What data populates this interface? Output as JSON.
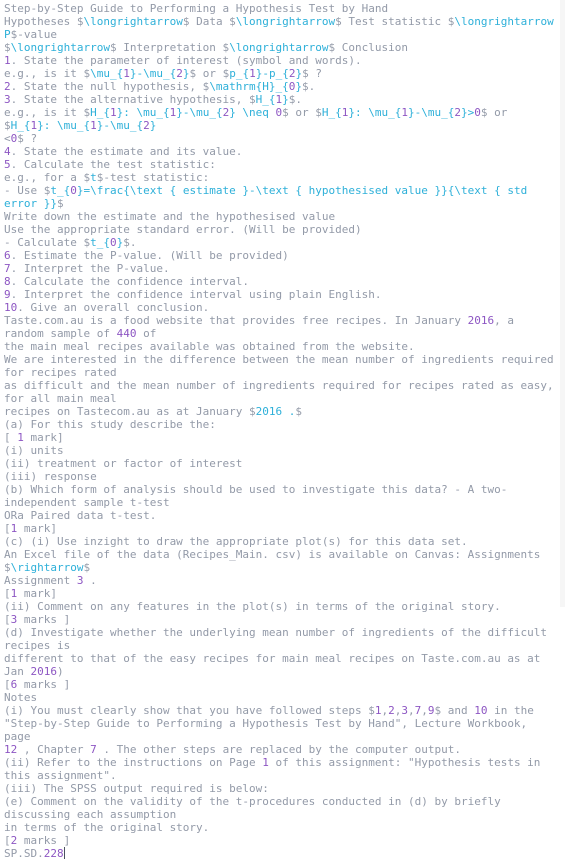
{
  "lines": [
    {
      "segs": [
        [
          "Step-by-Step Guide to Performing a Hypothesis Test by Hand",
          ""
        ]
      ]
    },
    {
      "segs": [
        [
          "Hypotheses $",
          ""
        ],
        [
          "\\longrightarrow",
          "math"
        ],
        [
          "$ Data $",
          ""
        ],
        [
          "\\longrightarrow",
          "math"
        ],
        [
          "$ Test statistic $",
          ""
        ],
        [
          "\\longrightarrow P",
          "math"
        ],
        [
          "$-value",
          ""
        ]
      ]
    },
    {
      "segs": [
        [
          "$",
          ""
        ],
        [
          "\\longrightarrow",
          "math"
        ],
        [
          "$ Interpretation $",
          ""
        ],
        [
          "\\longrightarrow",
          "math"
        ],
        [
          "$ Conclusion",
          ""
        ]
      ]
    },
    {
      "segs": [
        [
          "1",
          "num"
        ],
        [
          ". State the parameter of interest (symbol and words).",
          ""
        ]
      ]
    },
    {
      "segs": [
        [
          "e.g., is it $",
          ""
        ],
        [
          "\\mu_{",
          "math"
        ],
        [
          "1",
          "num"
        ],
        [
          "}-\\mu_{",
          "math"
        ],
        [
          "2",
          "num"
        ],
        [
          "}",
          "math"
        ],
        [
          "$ or $",
          ""
        ],
        [
          "p_{",
          "math"
        ],
        [
          "1",
          "num"
        ],
        [
          "}-p_{",
          "math"
        ],
        [
          "2",
          "num"
        ],
        [
          "}",
          "math"
        ],
        [
          "$ ?",
          ""
        ]
      ]
    },
    {
      "segs": [
        [
          "2",
          "num"
        ],
        [
          ". State the null hypothesis, $",
          ""
        ],
        [
          "\\mathrm{H}_{",
          "math"
        ],
        [
          "0",
          "num"
        ],
        [
          "}",
          "math"
        ],
        [
          "$.",
          ""
        ]
      ]
    },
    {
      "segs": [
        [
          "3",
          "num"
        ],
        [
          ". State the alternative hypothesis, $",
          ""
        ],
        [
          "H_{",
          "math"
        ],
        [
          "1",
          "num"
        ],
        [
          "}",
          "math"
        ],
        [
          "$.",
          ""
        ]
      ]
    },
    {
      "segs": [
        [
          "e.g., is it $",
          ""
        ],
        [
          "H_{",
          "math"
        ],
        [
          "1",
          "num"
        ],
        [
          "}: \\mu_{",
          "math"
        ],
        [
          "1",
          "num"
        ],
        [
          "}-\\mu_{",
          "math"
        ],
        [
          "2",
          "num"
        ],
        [
          "} \\neq ",
          "math"
        ],
        [
          "0",
          "num"
        ],
        [
          "$ or $",
          ""
        ],
        [
          "H_{",
          "math"
        ],
        [
          "1",
          "num"
        ],
        [
          "}: \\mu_{",
          "math"
        ],
        [
          "1",
          "num"
        ],
        [
          "}-\\mu_{",
          "math"
        ],
        [
          "2",
          "num"
        ],
        [
          "}>",
          "math"
        ],
        [
          "0",
          "num"
        ],
        [
          "$ or $",
          ""
        ],
        [
          "H_{",
          "math"
        ],
        [
          "1",
          "num"
        ],
        [
          "}: \\mu_{",
          "math"
        ],
        [
          "1",
          "num"
        ],
        [
          "}-\\mu_{",
          "math"
        ],
        [
          "2",
          "num"
        ],
        [
          "}",
          "math"
        ]
      ]
    },
    {
      "segs": [
        [
          "<",
          ""
        ],
        [
          "0",
          "num"
        ],
        [
          "$ ?",
          ""
        ]
      ]
    },
    {
      "segs": [
        [
          "4",
          "num"
        ],
        [
          ". State the estimate and its value.",
          ""
        ]
      ]
    },
    {
      "segs": [
        [
          "5",
          "num"
        ],
        [
          ". Calculate the test statistic:",
          ""
        ]
      ]
    },
    {
      "segs": [
        [
          "e.g., for a $",
          ""
        ],
        [
          "t",
          "math"
        ],
        [
          "$-test statistic:",
          ""
        ]
      ]
    },
    {
      "segs": [
        [
          "- Use $",
          ""
        ],
        [
          "t_{",
          "math"
        ],
        [
          "0",
          "num"
        ],
        [
          "}=\\frac{\\text { estimate }-\\text { hypothesised value }}{\\text { std error }}",
          "math"
        ],
        [
          "$",
          ""
        ]
      ]
    },
    {
      "segs": [
        [
          "Write down the estimate and the hypothesised value",
          ""
        ]
      ]
    },
    {
      "segs": [
        [
          "Use the appropriate standard error. (Will be provided)",
          ""
        ]
      ]
    },
    {
      "segs": [
        [
          "- Calculate $",
          ""
        ],
        [
          "t_{",
          "math"
        ],
        [
          "0",
          "num"
        ],
        [
          "}",
          "math"
        ],
        [
          "$.",
          ""
        ]
      ]
    },
    {
      "segs": [
        [
          "6",
          "num"
        ],
        [
          ". Estimate the P-value. (Will be provided)",
          ""
        ]
      ]
    },
    {
      "segs": [
        [
          "7",
          "num"
        ],
        [
          ". Interpret the P-value.",
          ""
        ]
      ]
    },
    {
      "segs": [
        [
          "8",
          "num"
        ],
        [
          ". Calculate the confidence interval.",
          ""
        ]
      ]
    },
    {
      "segs": [
        [
          "9",
          "num"
        ],
        [
          ". Interpret the confidence interval using plain English.",
          ""
        ]
      ]
    },
    {
      "segs": [
        [
          "10",
          "num"
        ],
        [
          ". Give an overall conclusion.",
          ""
        ]
      ]
    },
    {
      "segs": [
        [
          "Taste.com.au is a food website that provides free recipes. In January ",
          ""
        ],
        [
          "2016",
          "num"
        ],
        [
          ", a random sample of ",
          ""
        ],
        [
          "440",
          "num"
        ],
        [
          " of",
          ""
        ]
      ]
    },
    {
      "segs": [
        [
          "the main meal recipes available was obtained from the website.",
          ""
        ]
      ]
    },
    {
      "segs": [
        [
          "We are interested in the difference between the mean number of ingredients required for recipes rated",
          ""
        ]
      ]
    },
    {
      "segs": [
        [
          "as difficult and the mean number of ingredients required for recipes rated as easy, for all main meal",
          ""
        ]
      ]
    },
    {
      "segs": [
        [
          "recipes on Tastecom.au as at January $",
          ""
        ],
        [
          "2016 .",
          "math"
        ],
        [
          "$",
          ""
        ]
      ]
    },
    {
      "segs": [
        [
          "(a) For this study describe the:",
          ""
        ]
      ]
    },
    {
      "segs": [
        [
          "[ ",
          ""
        ],
        [
          "1",
          "num"
        ],
        [
          " mark]",
          ""
        ]
      ]
    },
    {
      "segs": [
        [
          "(i) units",
          ""
        ]
      ]
    },
    {
      "segs": [
        [
          "(ii) treatment or factor of interest",
          ""
        ]
      ]
    },
    {
      "segs": [
        [
          "(iii) response",
          ""
        ]
      ]
    },
    {
      "segs": [
        [
          "(b) Which form of analysis should be used to investigate this data? - A two-independent sample t-test",
          ""
        ]
      ]
    },
    {
      "segs": [
        [
          "ORa Paired data t-test.",
          ""
        ]
      ]
    },
    {
      "segs": [
        [
          "[",
          ""
        ],
        [
          "1",
          "num"
        ],
        [
          " mark]",
          ""
        ]
      ]
    },
    {
      "segs": [
        [
          "(c) (i) Use inzight to draw the appropriate plot(s) for this data set.",
          ""
        ]
      ]
    },
    {
      "segs": [
        [
          "An Excel file of the data (Recipes_Main. csv) is available on Canvas: Assignments $",
          ""
        ],
        [
          "\\rightarrow",
          "math"
        ],
        [
          "$",
          ""
        ]
      ]
    },
    {
      "segs": [
        [
          "Assignment ",
          ""
        ],
        [
          "3",
          "num"
        ],
        [
          " .",
          ""
        ]
      ]
    },
    {
      "segs": [
        [
          "[",
          ""
        ],
        [
          "1",
          "num"
        ],
        [
          " mark]",
          ""
        ]
      ]
    },
    {
      "segs": [
        [
          "(ii) Comment on any features in the plot(s) in terms of the original story.",
          ""
        ]
      ]
    },
    {
      "segs": [
        [
          "[",
          ""
        ],
        [
          "3",
          "num"
        ],
        [
          " marks ]",
          ""
        ]
      ]
    },
    {
      "segs": [
        [
          "(d) Investigate whether the underlying mean number of ingredients of the difficult recipes is",
          ""
        ]
      ]
    },
    {
      "segs": [
        [
          "different to that of the easy recipes for main meal recipes on Taste.com.au as at Jan ",
          ""
        ],
        [
          "2016",
          "num"
        ],
        [
          ")",
          ""
        ]
      ]
    },
    {
      "segs": [
        [
          "[",
          ""
        ],
        [
          "6",
          "num"
        ],
        [
          " marks ]",
          ""
        ]
      ]
    },
    {
      "segs": [
        [
          "Notes",
          ""
        ]
      ]
    },
    {
      "segs": [
        [
          "(i) You must clearly show that you have followed steps $",
          ""
        ],
        [
          "1",
          "num"
        ],
        [
          ",",
          ""
        ],
        [
          "2",
          "num"
        ],
        [
          ",",
          ""
        ],
        [
          "3",
          "num"
        ],
        [
          ",",
          ""
        ],
        [
          "7",
          "num"
        ],
        [
          ",",
          ""
        ],
        [
          "9",
          "num"
        ],
        [
          "$ and ",
          ""
        ],
        [
          "10",
          "num"
        ],
        [
          " in the",
          ""
        ]
      ]
    },
    {
      "segs": [
        [
          "\"Step-by-Step Guide to Performing a Hypothesis Test by Hand\", Lecture Workbook, page",
          ""
        ]
      ]
    },
    {
      "segs": [
        [
          "12",
          "num"
        ],
        [
          " , Chapter ",
          ""
        ],
        [
          "7",
          "num"
        ],
        [
          " . The other steps are replaced by the computer output.",
          ""
        ]
      ]
    },
    {
      "segs": [
        [
          "(ii) Refer to the instructions on Page ",
          ""
        ],
        [
          "1",
          "num"
        ],
        [
          " of this assignment: \"Hypothesis tests in this assignment\".",
          ""
        ]
      ]
    },
    {
      "segs": [
        [
          "(iii) The SPSS output required is below:",
          ""
        ]
      ]
    },
    {
      "segs": [
        [
          "(e) Comment on the validity of the t-procedures conducted in (d) by briefly discussing each assumption",
          ""
        ]
      ]
    },
    {
      "segs": [
        [
          "in terms of the original story.",
          ""
        ]
      ]
    },
    {
      "segs": [
        [
          "[",
          ""
        ],
        [
          "2",
          "num"
        ],
        [
          " marks ]",
          ""
        ]
      ]
    },
    {
      "segs": [
        [
          "SP.SD.",
          ""
        ],
        [
          "228",
          "num"
        ]
      ],
      "cursor": true
    }
  ]
}
